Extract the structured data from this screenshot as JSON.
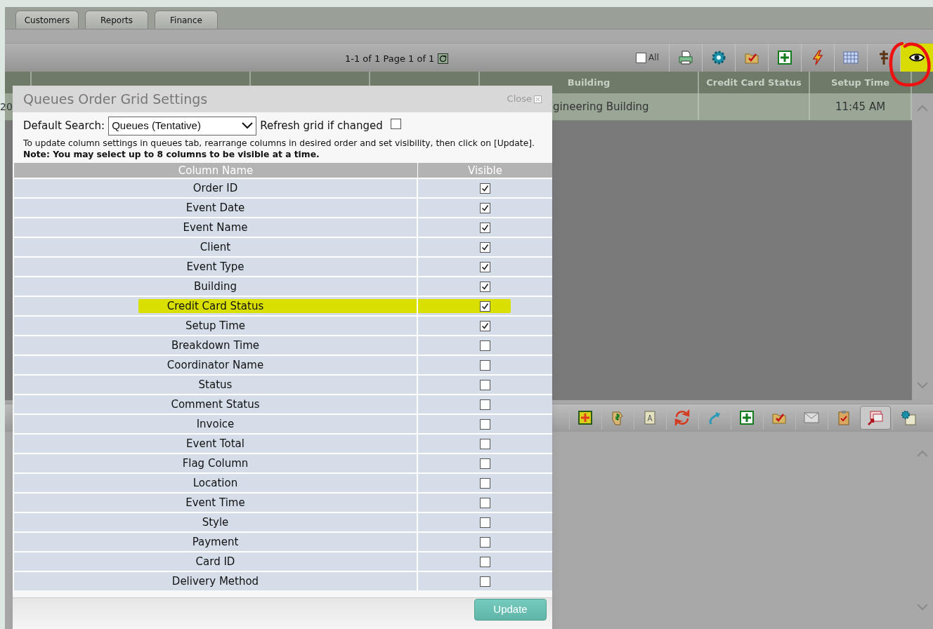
{
  "tabs": [
    {
      "label": "Customers"
    },
    {
      "label": "Reports"
    },
    {
      "label": "Finance"
    }
  ],
  "toolbar": {
    "pagination": "1-1 of 1 Page 1 of 1",
    "all_checkbox": {
      "label": "All",
      "checked": false
    },
    "buttons": [
      {
        "kind": "printer",
        "highlighted": false,
        "circled": false
      },
      {
        "kind": "gear",
        "highlighted": false,
        "circled": false
      },
      {
        "kind": "folder-check",
        "highlighted": false,
        "circled": false
      },
      {
        "kind": "plus",
        "highlighted": false,
        "circled": false
      },
      {
        "kind": "lightning",
        "highlighted": false,
        "circled": false
      },
      {
        "kind": "grid",
        "highlighted": false,
        "circled": false
      },
      {
        "kind": "signpost",
        "highlighted": false,
        "circled": false
      },
      {
        "kind": "eye",
        "highlighted": true,
        "circled": true
      }
    ]
  },
  "grid": {
    "columns": [
      {
        "label": "Building"
      },
      {
        "label": "Credit Card Status"
      },
      {
        "label": "Setup Time"
      }
    ],
    "rows": [
      {
        "partial_cell": "20",
        "cells": [
          "gineering Building",
          "",
          "11:45 AM"
        ]
      }
    ]
  },
  "lower_toolbar": {
    "buttons": [
      {
        "kind": "plus-box",
        "pressed": false
      },
      {
        "kind": "hand-dollar",
        "pressed": false
      },
      {
        "kind": "notepad",
        "pressed": false
      },
      {
        "kind": "cycle",
        "pressed": false
      },
      {
        "kind": "arrow",
        "pressed": false
      },
      {
        "kind": "plus",
        "pressed": false
      },
      {
        "kind": "folder-check",
        "pressed": false
      },
      {
        "kind": "envelope",
        "pressed": false
      },
      {
        "kind": "clipboard",
        "pressed": false
      },
      {
        "kind": "windows-arrow",
        "pressed": true
      },
      {
        "kind": "gear-doc",
        "pressed": false
      }
    ]
  },
  "dialog": {
    "title": "Queues Order Grid Settings",
    "close": "Close",
    "default_search": {
      "label": "Default Search:",
      "value": "Queues (Tentative)"
    },
    "refresh": {
      "label": "Refresh grid if changed",
      "checked": false
    },
    "instructions": "To update column settings in queues tab, rearrange columns in desired order and set visibility, then click on [Update]. **Note: You may select up to 8 columns to be visible at a time.**",
    "table": {
      "columns": [
        "Column Name",
        "Visible"
      ],
      "rows": [
        {
          "name": "Order ID",
          "visible": true,
          "highlighted": false
        },
        {
          "name": "Event Date",
          "visible": true,
          "highlighted": false
        },
        {
          "name": "Event Name",
          "visible": true,
          "highlighted": false
        },
        {
          "name": "Client",
          "visible": true,
          "highlighted": false
        },
        {
          "name": "Event Type",
          "visible": true,
          "highlighted": false
        },
        {
          "name": "Building",
          "visible": true,
          "highlighted": false
        },
        {
          "name": "Credit Card Status",
          "visible": true,
          "highlighted": true
        },
        {
          "name": "Setup Time",
          "visible": true,
          "highlighted": false
        },
        {
          "name": "Breakdown Time",
          "visible": false,
          "highlighted": false
        },
        {
          "name": "Coordinator Name",
          "visible": false,
          "highlighted": false
        },
        {
          "name": "Status",
          "visible": false,
          "highlighted": false
        },
        {
          "name": "Comment Status",
          "visible": false,
          "highlighted": false
        },
        {
          "name": "Invoice",
          "visible": false,
          "highlighted": false
        },
        {
          "name": "Event Total",
          "visible": false,
          "highlighted": false
        },
        {
          "name": "Flag Column",
          "visible": false,
          "highlighted": false
        },
        {
          "name": "Location",
          "visible": false,
          "highlighted": false
        },
        {
          "name": "Event Time",
          "visible": false,
          "highlighted": false
        },
        {
          "name": "Style",
          "visible": false,
          "highlighted": false
        },
        {
          "name": "Payment",
          "visible": false,
          "highlighted": false
        },
        {
          "name": "Card ID",
          "visible": false,
          "highlighted": false
        },
        {
          "name": "Delivery Method",
          "visible": false,
          "highlighted": false
        }
      ]
    },
    "update_button": "Update"
  }
}
